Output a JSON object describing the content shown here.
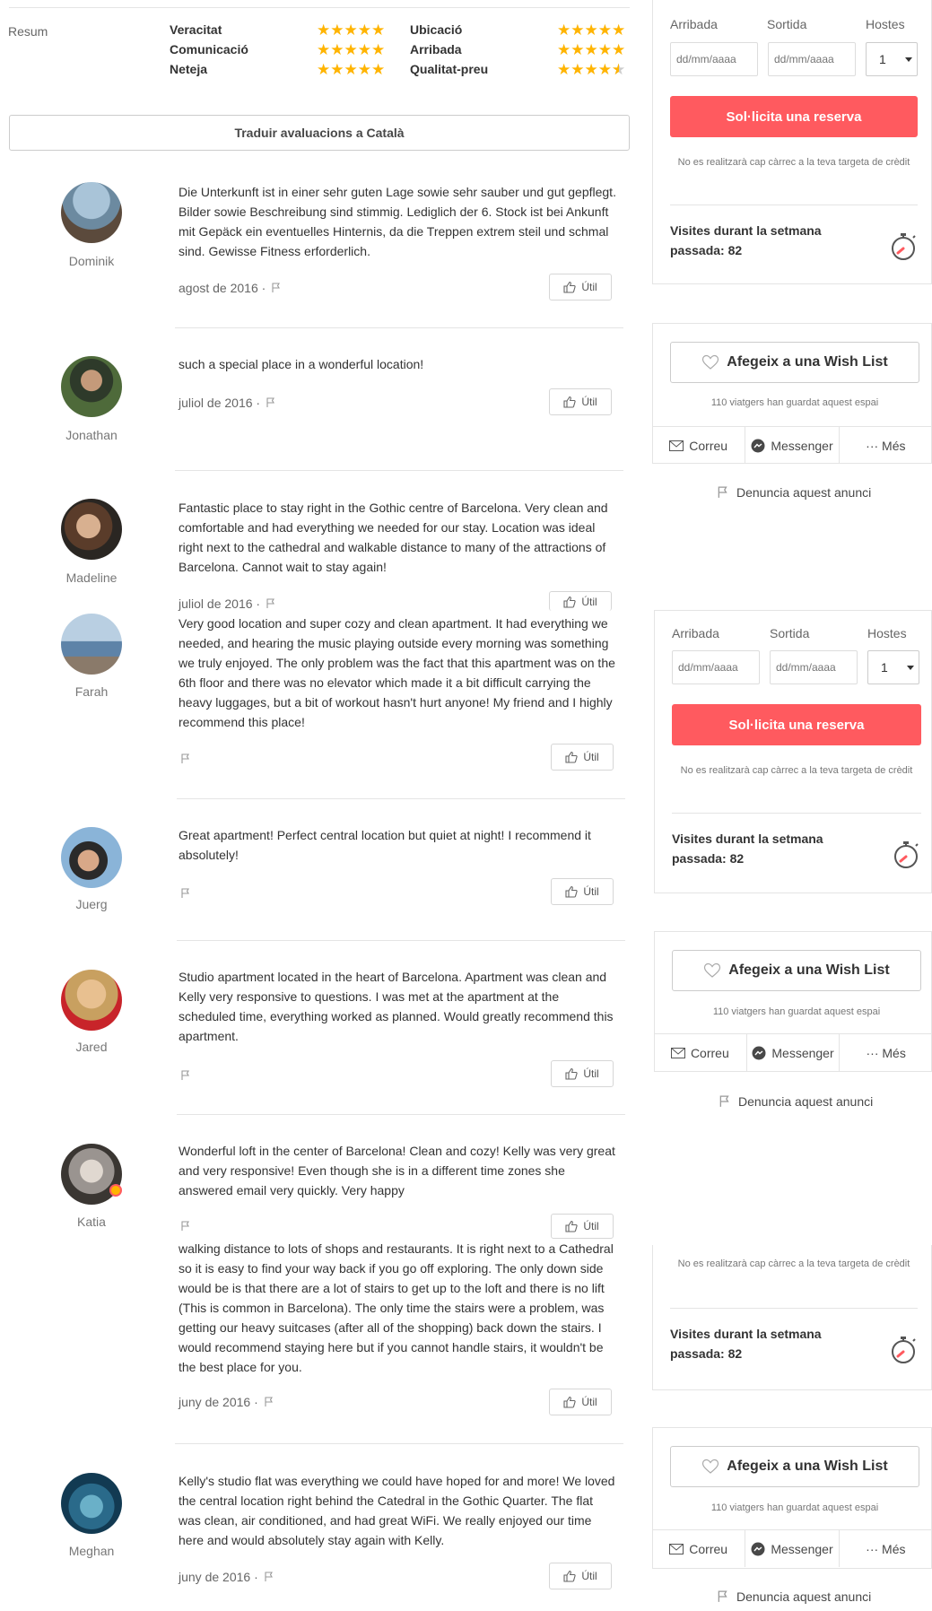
{
  "summary": {
    "label": "Resum",
    "ratings": [
      {
        "name": "Veracitat",
        "stars": 5
      },
      {
        "name": "Comunicació",
        "stars": 5
      },
      {
        "name": "Neteja",
        "stars": 5
      },
      {
        "name": "Ubicació",
        "stars": 5
      },
      {
        "name": "Arribada",
        "stars": 5
      },
      {
        "name": "Qualitat-preu",
        "stars": 4.5
      }
    ]
  },
  "translate_label": "Traduir avaluacions a Català",
  "helpful_label": "Útil",
  "reviews": [
    {
      "user": "Dominik",
      "text": "Die Unterkunft ist in einer sehr guten Lage sowie sehr sauber und gut gepflegt. Bilder sowie Beschreibung sind stimmig. Lediglich der 6. Stock ist bei Ankunft mit Gepäck ein eventuelles Hinternis, da die Treppen extrem steil und schmal sind. Gewisse Fitness erforderlich.",
      "date": "agost de 2016 ·"
    },
    {
      "user": "Jonathan",
      "text": "such a special place in a wonderful location!",
      "date": "juliol de 2016 ·"
    },
    {
      "user": "Madeline",
      "text": "Fantastic place to stay right in the Gothic centre of Barcelona. Very clean and comfortable and had everything we needed for our stay. Location was ideal right next to the cathedral and walkable distance to many of the attractions of Barcelona. Cannot wait to stay again!",
      "date": "juliol de 2016 ·"
    },
    {
      "user": "Farah",
      "text": "Very good location and super cozy and clean apartment. It had everything we needed, and hearing the music playing outside every morning was something we truly enjoyed. The only problem was the fact that this apartment was on the 6th floor and there was no elevator which made it a bit difficult carrying the heavy luggages, but a bit of workout hasn't hurt anyone! My friend and I highly recommend this place!",
      "date": ""
    },
    {
      "user": "Juerg",
      "text": "Great apartment! Perfect central location but quiet at night! I recommend it absolutely!",
      "date": ""
    },
    {
      "user": "Jared",
      "text": "Studio apartment located in the heart of Barcelona. Apartment was clean and Kelly very responsive to questions. I was met at the apartment at the scheduled time, everything worked as planned. Would greatly recommend this apartment.",
      "date": ""
    },
    {
      "user": "Katia",
      "text": "Wonderful loft in the center of Barcelona! Clean and cozy! Kelly was very great and very responsive! Even though she is in a different time zones she answered email very quickly. Very happy",
      "date": ""
    },
    {
      "user": "",
      "text": "walking distance to lots of shops and restaurants. It is right next to a Cathedral so it is easy to find your way back if you go off exploring. The only down side would be is that there are a lot of stairs to get up to the loft and there is no lift (This is common in Barcelona). The only time the stairs were a problem, was getting our heavy suitcases (after all of the shopping) back down the stairs. I would recommend staying here but if you cannot handle stairs, it wouldn't be the best place for you.",
      "date": "juny de 2016 ·"
    },
    {
      "user": "Meghan",
      "text": "Kelly's studio flat was everything we could have hoped for and more! We loved the central location right behind the Catedral in the Gothic Quarter. The flat was clean, air conditioned, and had great WiFi. We really enjoyed our time here and would absolutely stay again with Kelly.",
      "date": "juny de 2016 ·"
    }
  ],
  "booking": {
    "arrival_label": "Arribada",
    "departure_label": "Sortida",
    "guests_label": "Hostes",
    "date_placeholder": "dd/mm/aaaa",
    "guests_value": "1",
    "request_label": "Sol·licita una reserva",
    "no_charge_note": "No es realitzarà cap càrrec a la teva targeta de crèdit",
    "visits_text": "Visites durant la setmana passada: 82"
  },
  "wishlist": {
    "add_label": "Afegeix a una Wish List",
    "saved_text": "110 viatgers han guardat aquest espai",
    "share": [
      "Correu",
      "Messenger",
      "··· Més"
    ],
    "report_label": "Denuncia aquest anunci"
  },
  "colors": {
    "accent": "#ff5a5f",
    "star": "#ffb400",
    "text": "#484848"
  }
}
